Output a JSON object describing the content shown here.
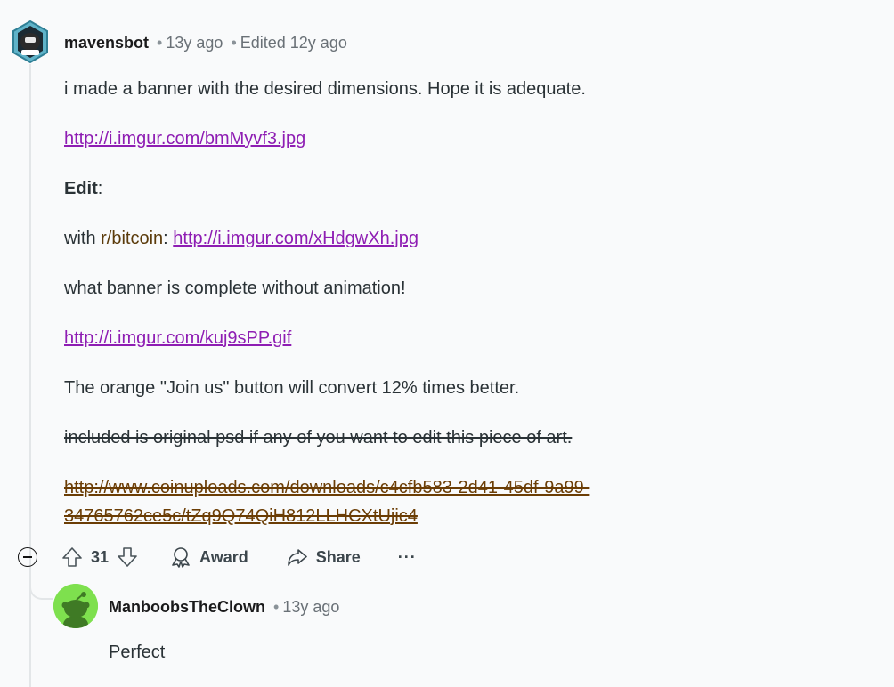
{
  "comment": {
    "username": "mavensbot",
    "age": "13y ago",
    "edited": "Edited 12y ago",
    "body": {
      "line1": "i made a banner with the desired dimensions. Hope it is adequate.",
      "link1": "http://i.imgur.com/bmMyvf3.jpg",
      "edit_label": "Edit",
      "edit_colon": ":",
      "with_prefix": "with ",
      "subreddit": "r/bitcoin",
      "with_colon": ": ",
      "link2": "http://i.imgur.com/xHdgwXh.jpg",
      "line_animation": "what banner is complete without animation!",
      "link3": "http://i.imgur.com/kuj9sPP.gif",
      "line_join": "The orange \"Join us\" button will convert 12% times better.",
      "strike_line": "included is original psd if any of you want to edit this piece of art.",
      "strike_link_part1": "http://www.coinuploads.com/downloads/c4cfb583-2d41-45df-9a99-",
      "strike_link_part2": "34765762ce5c/tZq9Q74QiH812LLHCXtUjic4"
    },
    "actions": {
      "score": "31",
      "award_label": "Award",
      "share_label": "Share",
      "more_label": "···"
    }
  },
  "reply": {
    "username": "ManboobsTheClown",
    "age": "13y ago",
    "body_start": "Perfect"
  },
  "icons": {
    "collapse": "minus-circle-icon",
    "upvote": "upvote-arrow-icon",
    "downvote": "downvote-arrow-icon",
    "award": "award-icon",
    "share": "share-icon",
    "more": "ellipsis-icon"
  },
  "colors": {
    "background": "#f9fafb",
    "link": "#8e1db3",
    "text": "#2a3236",
    "reply_avatar": "#7ee04e"
  }
}
